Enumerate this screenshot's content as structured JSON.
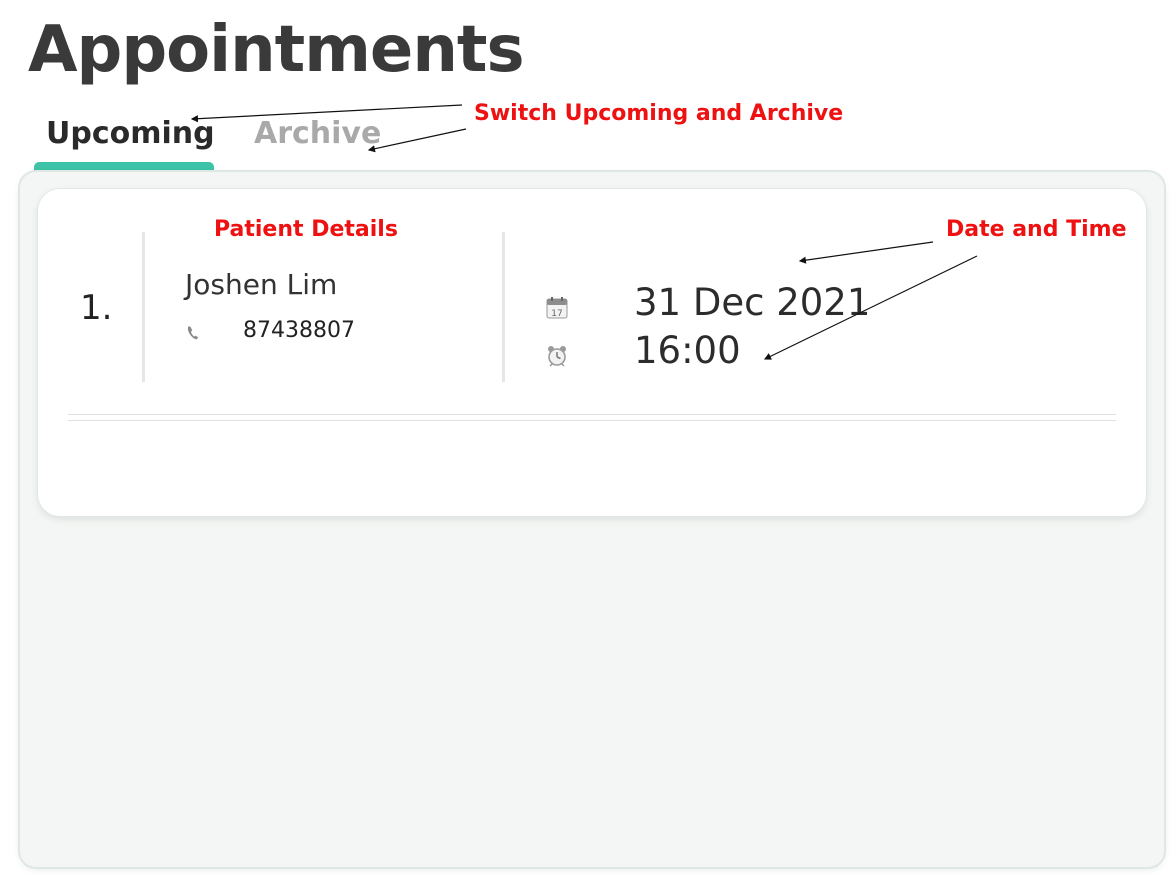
{
  "page": {
    "title": "Appointments"
  },
  "tabs": [
    {
      "label": "Upcoming",
      "active": true
    },
    {
      "label": "Archive",
      "active": false
    }
  ],
  "colors": {
    "accent": "#3cc3a8",
    "annotation": "#ee1111",
    "panel_background": "#f4f6f5"
  },
  "appointments": [
    {
      "index": "1.",
      "patient_name": "Joshen Lim",
      "phone": "87438807",
      "phone_icon": "phone-icon",
      "date": "31 Dec 2021",
      "date_icon": "calendar-icon",
      "time": "16:00",
      "time_icon": "alarm-clock-icon"
    }
  ],
  "annotations": {
    "tabs_note": "Switch Upcoming and Archive",
    "patient_note": "Patient Details",
    "datetime_note": "Date and Time"
  }
}
